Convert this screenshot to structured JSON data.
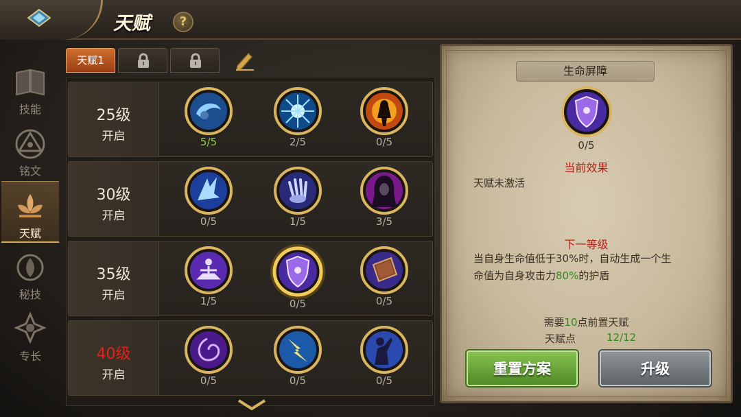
{
  "header": {
    "title": "天赋",
    "help_label": "?"
  },
  "sidenav": {
    "items": [
      {
        "label": "技能",
        "icon": "book-icon"
      },
      {
        "label": "铭文",
        "icon": "rune-triangle-icon"
      },
      {
        "label": "天赋",
        "icon": "talent-lotus-icon",
        "active": true
      },
      {
        "label": "秘技",
        "icon": "secret-flame-icon"
      },
      {
        "label": "专长",
        "icon": "specialty-emblem-icon"
      }
    ]
  },
  "tabs": [
    {
      "label": "天赋1",
      "active": true
    },
    {
      "label": "",
      "locked": true,
      "icon": "lock-icon"
    },
    {
      "label": "",
      "locked": true,
      "icon": "lock-icon"
    }
  ],
  "talents": {
    "rows": [
      {
        "level": "25级",
        "unlock": "开启",
        "locked": false,
        "skills": [
          {
            "icon": "water-orb-icon",
            "count": "5/5",
            "full": true
          },
          {
            "icon": "ice-burst-icon",
            "count": "2/5"
          },
          {
            "icon": "fire-figure-icon",
            "count": "0/5"
          }
        ]
      },
      {
        "level": "30级",
        "unlock": "开启",
        "locked": false,
        "skills": [
          {
            "icon": "ice-crystal-icon",
            "count": "0/5"
          },
          {
            "icon": "claw-hand-icon",
            "count": "1/5"
          },
          {
            "icon": "hooded-figure-icon",
            "count": "3/5"
          }
        ]
      },
      {
        "level": "35级",
        "unlock": "开启",
        "locked": false,
        "skills": [
          {
            "icon": "meditation-icon",
            "count": "1/5"
          },
          {
            "icon": "shield-icon",
            "count": "0/5",
            "selected": true
          },
          {
            "icon": "tome-icon",
            "count": "0/5"
          }
        ]
      },
      {
        "level": "40级",
        "unlock": "开启",
        "locked": true,
        "skills": [
          {
            "icon": "vortex-icon",
            "count": "0/5"
          },
          {
            "icon": "lightning-slash-icon",
            "count": "0/5"
          },
          {
            "icon": "warrior-silhouette-icon",
            "count": "0/5"
          }
        ]
      }
    ]
  },
  "detail": {
    "title": "生命屏障",
    "icon": "shield-icon",
    "count": "0/5",
    "current_effect_header": "当前效果",
    "current_effect": "天赋未激活",
    "next_level_header": "下一等级",
    "next_desc_1": "当自身生命值低于30%时，自动生成一个生",
    "next_desc_2": "命值为自身攻击力",
    "next_desc_hl": "80%",
    "next_desc_3": "的护盾",
    "req_prefix": "需要",
    "req_value": "10",
    "req_suffix": "点前置天赋",
    "points_label": "天赋点",
    "points_value": "12/12",
    "reset_label": "重置方案",
    "upgrade_label": "升级"
  },
  "colors": {
    "accent_gold": "#d7aa5a",
    "full_green": "#8fd43c",
    "locked_red": "#e2231a",
    "reset_green": "#5f9a30",
    "upgrade_grey": "#74797d"
  }
}
